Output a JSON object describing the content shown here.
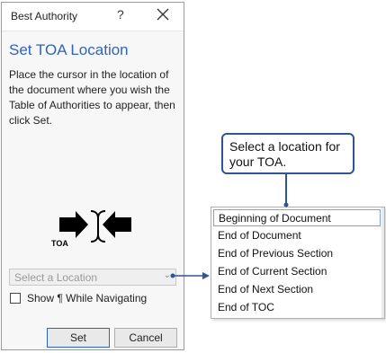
{
  "dialog": {
    "title": "Best Authority",
    "help_label": "?",
    "heading": "Set TOA Location",
    "instructions": "Place the cursor in the location of the document where you wish the Table of Authorities to appear, then click Set.",
    "graphic_label": "TOA",
    "location_placeholder": "Select a Location",
    "show_checkbox_label": "Show ¶ While Navigating",
    "show_checked": false,
    "set_label": "Set",
    "cancel_label": "Cancel"
  },
  "callout": {
    "text": "Select a location for your TOA."
  },
  "dropdown": {
    "items": [
      "Beginning of Document",
      "End of Document",
      "End of Previous Section",
      "End of Current Section",
      "End of Next Section",
      "End of TOC"
    ],
    "highlighted_index": 0
  },
  "colors": {
    "accent": "#2e63b8",
    "callout_border": "#2f5597",
    "connector": "#2f5597"
  }
}
